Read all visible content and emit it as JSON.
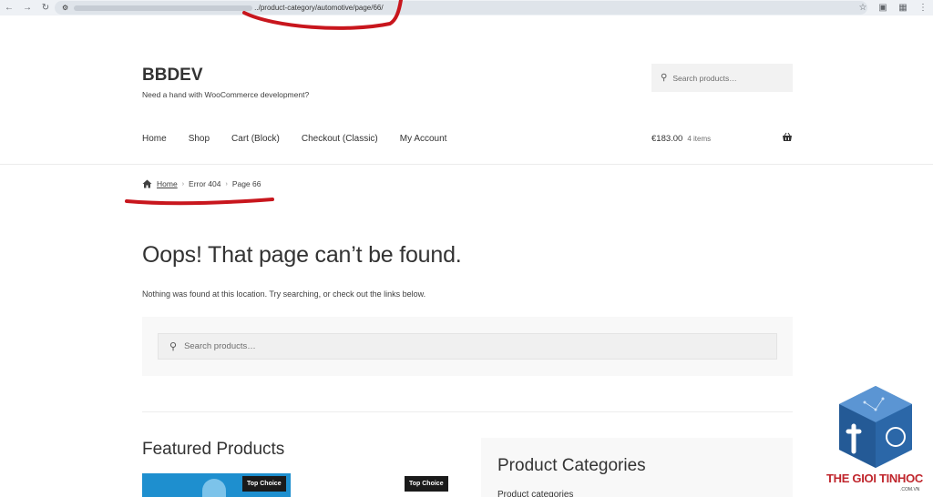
{
  "browser": {
    "back_icon": "arrow-left-icon",
    "forward_icon": "arrow-right-icon",
    "reload_icon": "reload-icon",
    "url_visible": "../product-category/automotive/page/66/"
  },
  "site": {
    "title": "BBDEV",
    "tagline": "Need a hand with WooCommerce development?",
    "search_placeholder": "Search products…"
  },
  "nav": {
    "items": [
      {
        "label": "Home"
      },
      {
        "label": "Shop"
      },
      {
        "label": "Cart (Block)"
      },
      {
        "label": "Checkout (Classic)"
      },
      {
        "label": "My Account"
      }
    ]
  },
  "cart": {
    "amount": "€183.00",
    "count": "4 items"
  },
  "breadcrumb": {
    "home": "Home",
    "error": "Error 404",
    "page": "Page 66"
  },
  "content": {
    "title": "Oops! That page can’t be found.",
    "message": "Nothing was found at this location. Try searching, or check out the links below.",
    "search_placeholder": "Search products…"
  },
  "featured": {
    "title": "Featured Products",
    "badge1": "Top Choice",
    "badge2": "Top Choice"
  },
  "categories": {
    "title": "Product Categories",
    "select_label": "Product categories"
  },
  "watermark": {
    "text": "THE GIOI TINHOC",
    "sub": ".COM.VN"
  },
  "colors": {
    "annotation_red": "#c8161d",
    "product_blue": "#1e8fcf"
  }
}
